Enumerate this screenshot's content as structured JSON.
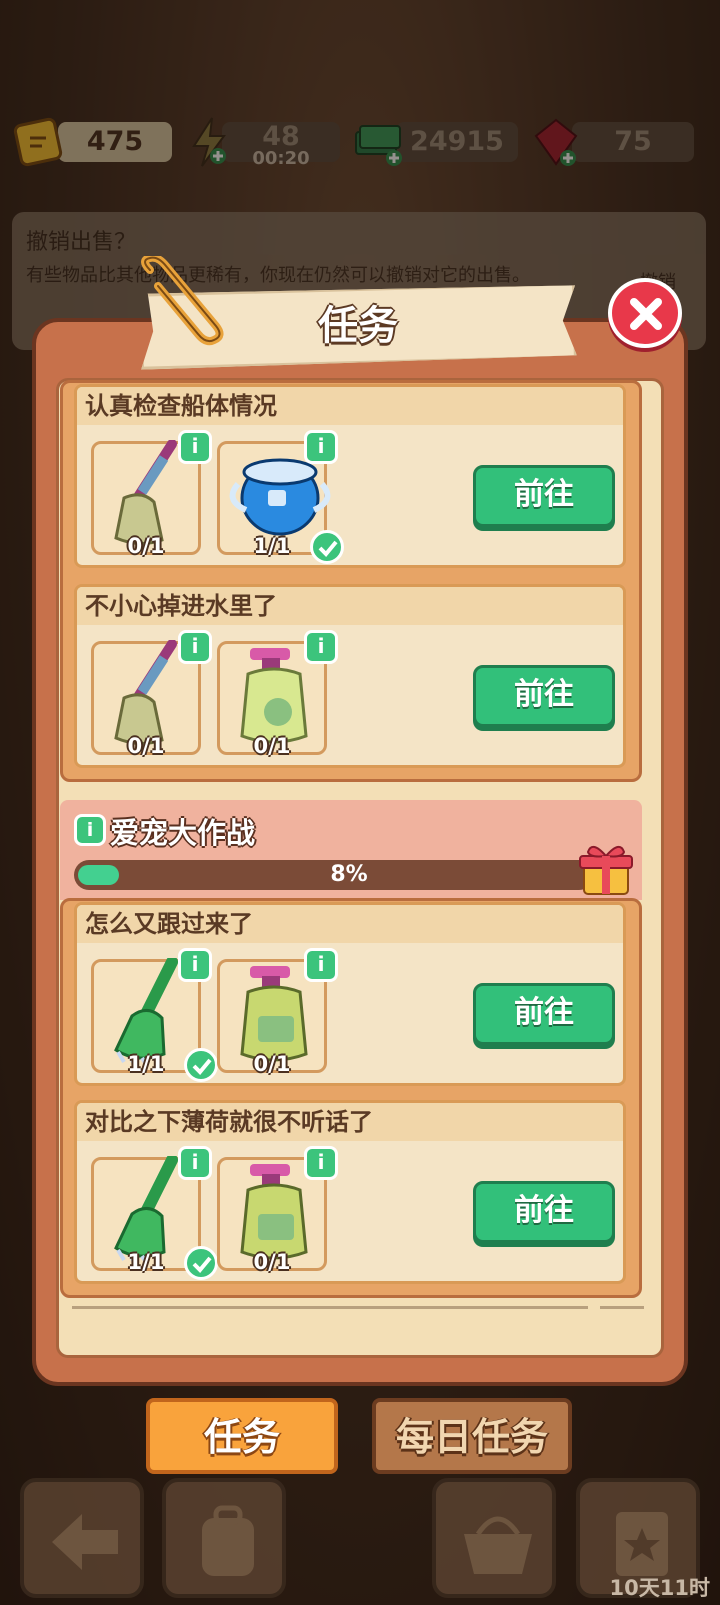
{
  "resources": {
    "tickets": "475",
    "energy": "48",
    "energy_timer": "00:20",
    "cash": "24915",
    "gems": "75"
  },
  "background_dialog": {
    "title": "撤销出售？",
    "text": "有些物品比其他物品更稀有，你现在仍然可以撤销对它的出售。",
    "button": "撤销"
  },
  "panel": {
    "title": "任务"
  },
  "tasks_group1": [
    {
      "title": "认真检查船体情况",
      "items": [
        {
          "icon": "mop-icon",
          "count": "0/1",
          "done": false
        },
        {
          "icon": "blue-bucket-icon",
          "count": "1/1",
          "done": true
        }
      ],
      "button": "前往"
    },
    {
      "title": "不小心掉进水里了",
      "items": [
        {
          "icon": "mop-icon",
          "count": "0/1",
          "done": false
        },
        {
          "icon": "detergent-bottle-icon",
          "count": "0/1",
          "done": false
        }
      ],
      "button": "前往"
    }
  ],
  "event": {
    "info": "i",
    "title": "爱宠大作战",
    "progress_text": "8%",
    "progress": 0.08
  },
  "tasks_group2": [
    {
      "title": "怎么又跟过来了",
      "items": [
        {
          "icon": "green-broom-icon",
          "count": "1/1",
          "done": true
        },
        {
          "icon": "detergent-bottle-icon",
          "count": "0/1",
          "done": false
        }
      ],
      "button": "前往"
    },
    {
      "title": "对比之下薄荷就很不听话了",
      "items": [
        {
          "icon": "green-broom-icon",
          "count": "1/1",
          "done": true
        },
        {
          "icon": "detergent-bottle-icon",
          "count": "0/1",
          "done": false
        }
      ],
      "button": "前往"
    }
  ],
  "info_badge": "i",
  "tabs": {
    "tasks": "任务",
    "daily": "每日任务"
  },
  "timer": "10天11时"
}
